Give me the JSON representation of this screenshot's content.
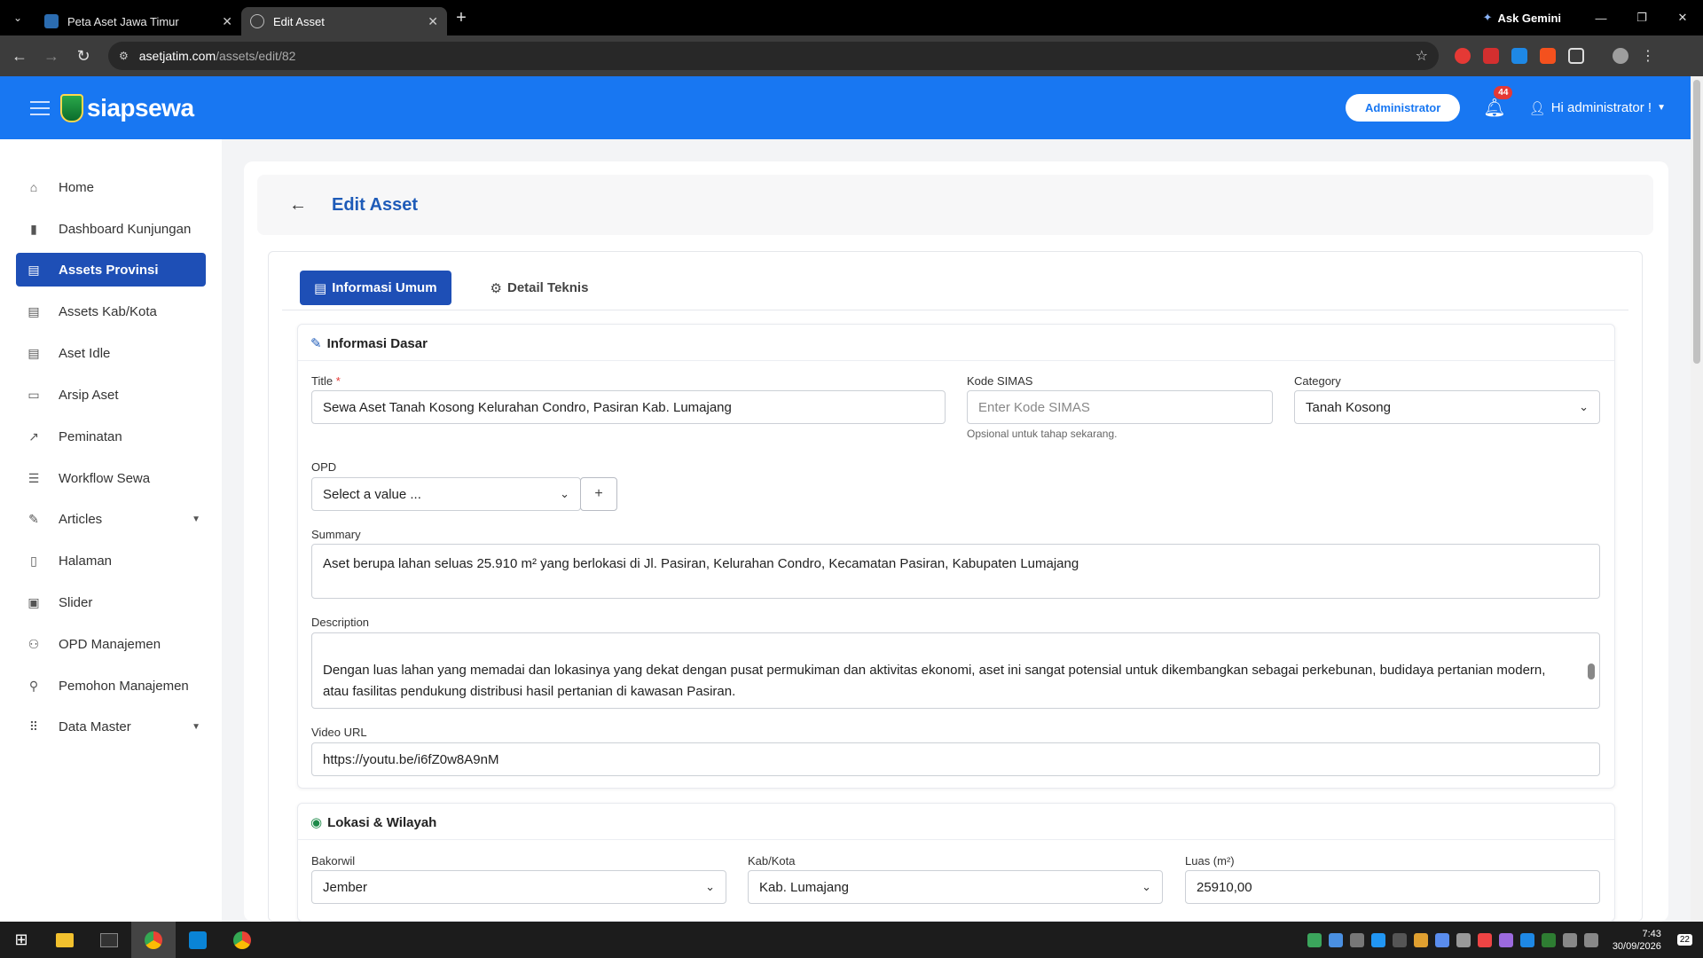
{
  "browser": {
    "tabs": [
      {
        "title": "Peta Aset Jawa Timur",
        "active": false
      },
      {
        "title": "Edit Asset",
        "active": true
      }
    ],
    "gemini_label": "Ask Gemini",
    "url_domain": "asetjatim.com",
    "url_path": "/assets/edit/82"
  },
  "header": {
    "brand": "siapsewa",
    "role_label": "Administrator",
    "notification_count": "44",
    "user_label": "Hi administrator !",
    "brand_color": "#1877f2"
  },
  "sidebar": {
    "items": [
      {
        "label": "Home",
        "icon": "home-icon"
      },
      {
        "label": "Dashboard Kunjungan",
        "icon": "bar-chart-icon"
      },
      {
        "label": "Assets Provinsi",
        "icon": "box-icon",
        "active": true
      },
      {
        "label": "Assets Kab/Kota",
        "icon": "box-icon"
      },
      {
        "label": "Aset Idle",
        "icon": "box-icon"
      },
      {
        "label": "Arsip Aset",
        "icon": "archive-icon"
      },
      {
        "label": "Peminatan",
        "icon": "trend-icon"
      },
      {
        "label": "Workflow Sewa",
        "icon": "list-icon"
      },
      {
        "label": "Articles",
        "icon": "edit-icon",
        "has_submenu": true
      },
      {
        "label": "Halaman",
        "icon": "page-icon"
      },
      {
        "label": "Slider",
        "icon": "images-icon"
      },
      {
        "label": "OPD Manajemen",
        "icon": "users-icon"
      },
      {
        "label": "Pemohon Manajemen",
        "icon": "user-icon"
      },
      {
        "label": "Data Master",
        "icon": "grid-icon",
        "has_submenu": true
      }
    ]
  },
  "page": {
    "title": "Edit Asset",
    "tabs": [
      {
        "label": "Informasi Umum",
        "active": true
      },
      {
        "label": "Detail Teknis",
        "active": false
      }
    ]
  },
  "informasi_dasar": {
    "heading": "Informasi Dasar",
    "title_label": "Title",
    "title_required": "*",
    "title_value": "Sewa Aset Tanah Kosong Kelurahan Condro, Pasiran Kab. Lumajang",
    "kode_simas_label": "Kode SIMAS",
    "kode_simas_placeholder": "Enter Kode SIMAS",
    "kode_simas_hint": "Opsional untuk tahap sekarang.",
    "category_label": "Category",
    "category_value": "Tanah Kosong",
    "opd_label": "OPD",
    "opd_placeholder": "Select a value ...",
    "opd_add": "+",
    "summary_label": "Summary",
    "summary_value": "Aset berupa lahan seluas 25.910 m² yang berlokasi di Jl. Pasiran, Kelurahan Condro, Kecamatan Pasiran, Kabupaten Lumajang",
    "description_label": "Description",
    "description_value": "Dengan luas lahan yang memadai dan lokasinya yang dekat dengan pusat permukiman dan aktivitas ekonomi, aset ini sangat potensial untuk dikembangkan sebagai perkebunan, budidaya pertanian modern, atau fasilitas pendukung distribusi hasil pertanian di kawasan Pasiran.",
    "video_label": "Video URL",
    "video_value": "https://youtu.be/i6fZ0w8A9nM"
  },
  "lokasi": {
    "heading": "Lokasi & Wilayah",
    "bakorwil_label": "Bakorwil",
    "bakorwil_value": "Jember",
    "kabkota_label": "Kab/Kota",
    "kabkota_value": "Kab. Lumajang",
    "luas_label": "Luas (m²)",
    "luas_value": "25910,00"
  },
  "taskbar": {
    "time": "7:43",
    "date": "30/09/2026",
    "notif_count": "22"
  }
}
